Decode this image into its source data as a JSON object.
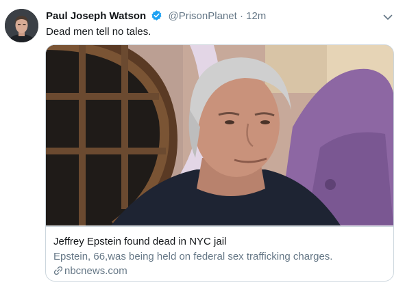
{
  "tweet": {
    "display_name": "Paul Joseph Watson",
    "handle": "@PrisonPlanet",
    "separator": "·",
    "time": "12m",
    "text": "Dead men tell no tales."
  },
  "card": {
    "title": "Jeffrey Epstein found dead in NYC jail",
    "description": "Epstein, 66,was being held on federal sex trafficking charges.",
    "domain": "nbcnews.com"
  },
  "icons": {
    "verified": "verified-badge-icon",
    "more": "chevron-down-icon",
    "link": "link-icon"
  },
  "colors": {
    "verified_blue": "#1da1f2",
    "secondary_text": "#657786",
    "border": "#ccd6dd"
  }
}
